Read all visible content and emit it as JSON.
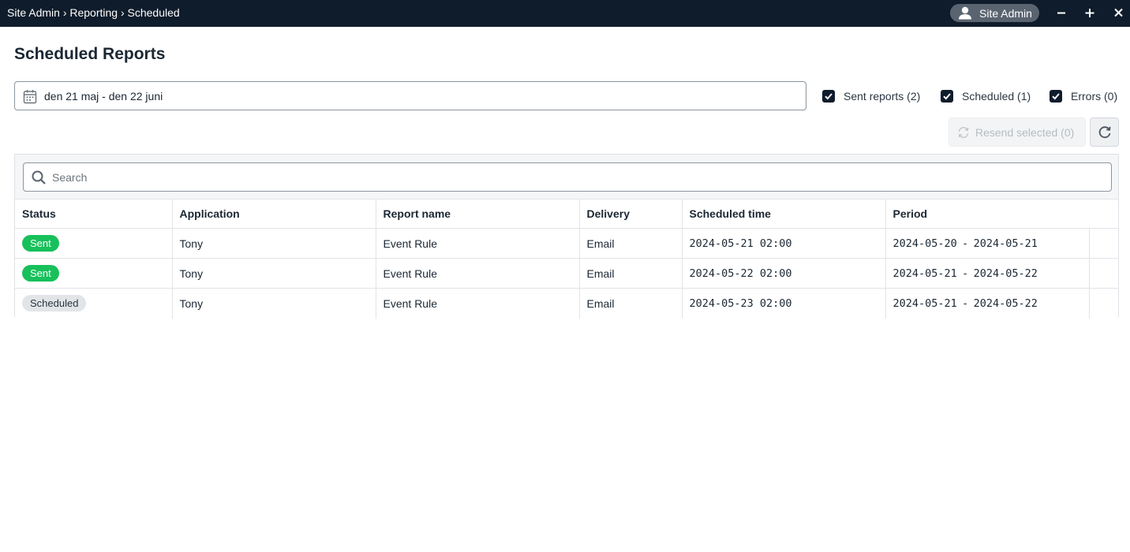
{
  "titlebar": {
    "breadcrumb": "Site Admin › Reporting › Scheduled",
    "user_label": "Site Admin"
  },
  "page": {
    "title": "Scheduled Reports"
  },
  "filters": {
    "date_range": "den 21 maj - den 22 juni",
    "sent_label": "Sent reports (2)",
    "scheduled_label": "Scheduled (1)",
    "errors_label": "Errors (0)",
    "sent_checked": true,
    "scheduled_checked": true,
    "errors_checked": true
  },
  "actions": {
    "resend_label": "Resend selected (0)"
  },
  "search": {
    "placeholder": "Search"
  },
  "table": {
    "columns": [
      "Status",
      "Application",
      "Report name",
      "Delivery",
      "Scheduled time",
      "Period"
    ],
    "rows": [
      {
        "status": "Sent",
        "application": "Tony",
        "report": "Event Rule",
        "delivery": "Email",
        "date": "2024-05-21",
        "time": "02:00",
        "period_start": "2024-05-20",
        "period_sep": "-",
        "period_end": "2024-05-21"
      },
      {
        "status": "Sent",
        "application": "Tony",
        "report": "Event Rule",
        "delivery": "Email",
        "date": "2024-05-22",
        "time": "02:00",
        "period_start": "2024-05-21",
        "period_sep": "-",
        "period_end": "2024-05-22"
      },
      {
        "status": "Scheduled",
        "application": "Tony",
        "report": "Event Rule",
        "delivery": "Email",
        "date": "2024-05-23",
        "time": "02:00",
        "period_start": "2024-05-21",
        "period_sep": "-",
        "period_end": "2024-05-22"
      }
    ]
  },
  "colors": {
    "titlebar": "#0f1c2b",
    "sent_badge": "#17c05b",
    "scheduled_badge": "#e2e5e8"
  }
}
